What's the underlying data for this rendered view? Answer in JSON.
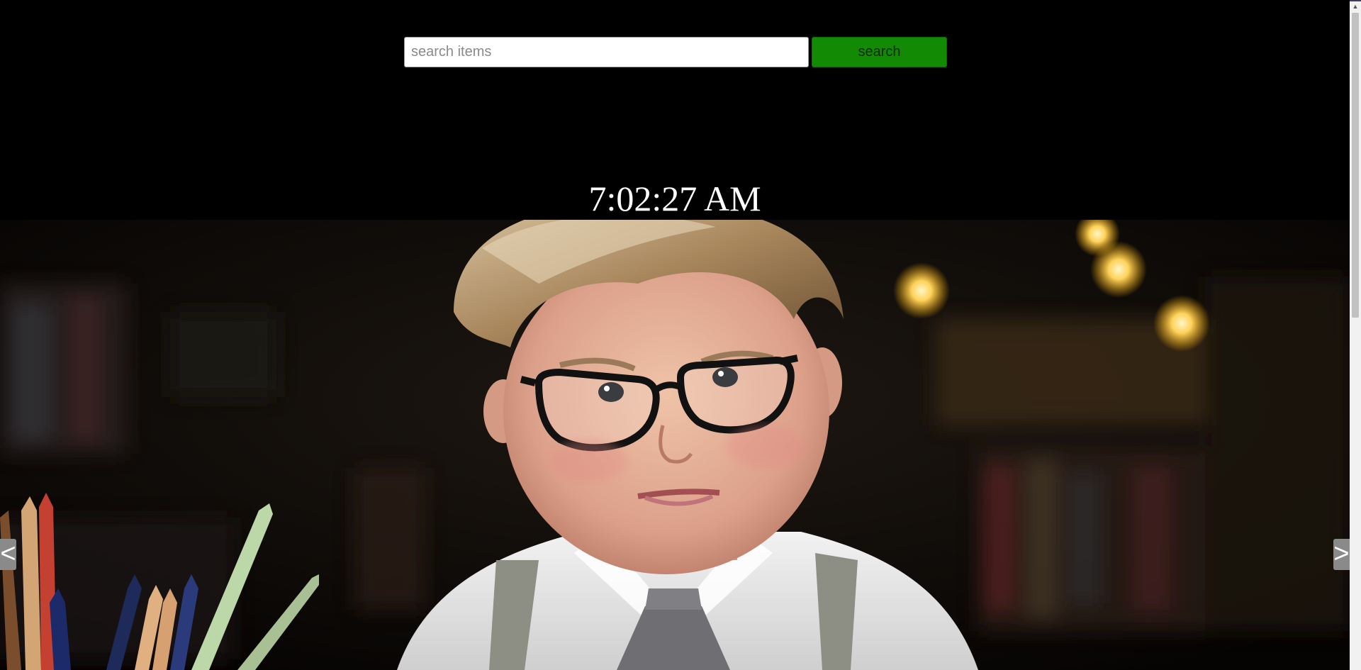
{
  "search": {
    "placeholder": "search items",
    "value": "",
    "button_label": "search",
    "button_color": "#138a03"
  },
  "clock": {
    "time": "7:02:27 AM"
  },
  "carousel": {
    "prev_label": "<",
    "next_label": ">",
    "image_subject": "boy-with-glasses-photo"
  },
  "scrollbar": {
    "up_arrow": "▲"
  },
  "colors": {
    "background": "#000000",
    "clock_text": "#ffffff",
    "arrow_bg": "#8a8a8a"
  }
}
